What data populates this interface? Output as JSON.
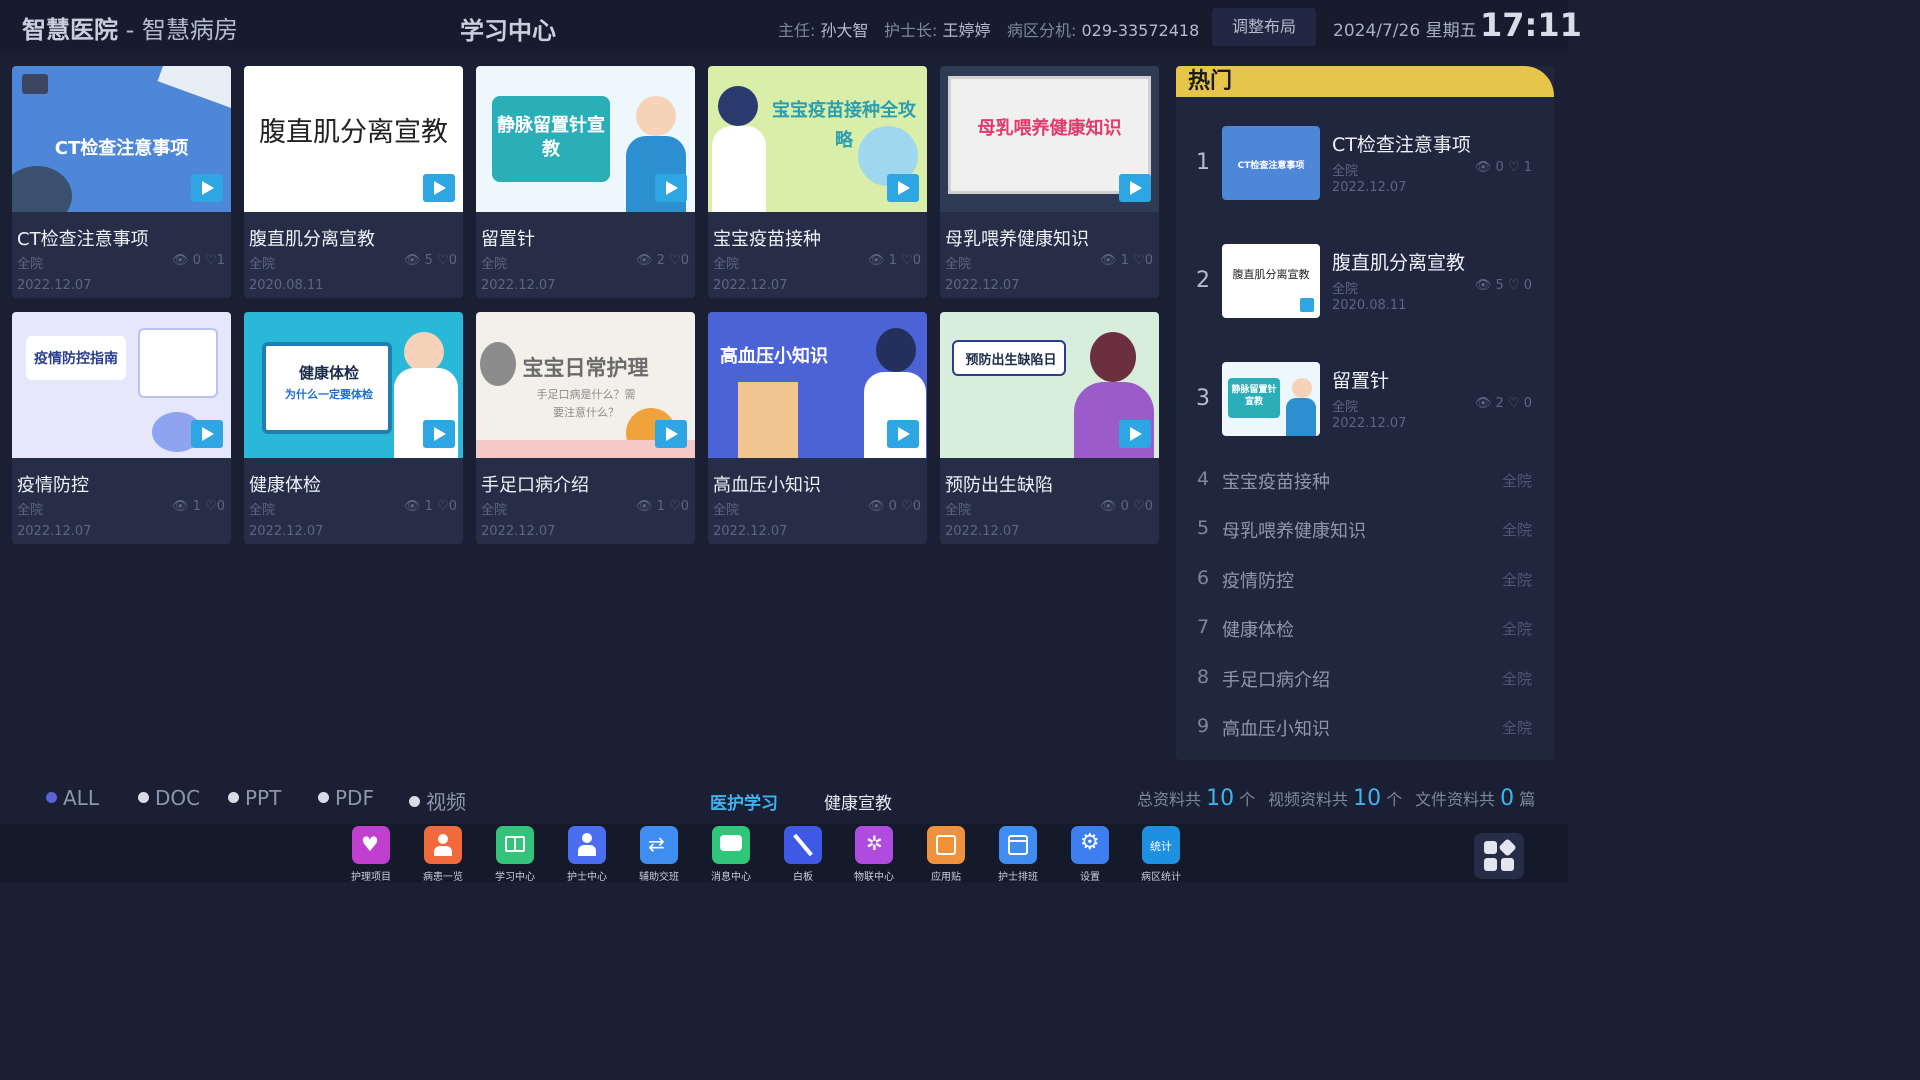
{
  "header": {
    "brand": "智慧医院",
    "subbrand": " - 智慧病房",
    "title": "学习中心",
    "director_label": "主任:",
    "director": "孙大智",
    "nurse_label": "护士长:",
    "nurse": "王婷婷",
    "ext_label": "病区分机:",
    "ext": "029-33572418",
    "layout_button": "调整布局",
    "date": "2024/7/26 星期五",
    "time": "17:11"
  },
  "cards": [
    {
      "title": "CT检查注意事项",
      "thumb_text": "CT检查注意事项",
      "scope": "全院",
      "views": "0",
      "likes": "1",
      "date": "2022.12.07"
    },
    {
      "title": "腹直肌分离宣教",
      "thumb_text": "腹直肌分离宣教",
      "scope": "全院",
      "views": "5",
      "likes": "0",
      "date": "2020.08.11"
    },
    {
      "title": "留置针",
      "thumb_text": "静脉留置针宣教",
      "scope": "全院",
      "views": "2",
      "likes": "0",
      "date": "2022.12.07"
    },
    {
      "title": "宝宝疫苗接种",
      "thumb_text": "宝宝疫苗接种全攻略",
      "scope": "全院",
      "views": "1",
      "likes": "0",
      "date": "2022.12.07"
    },
    {
      "title": "母乳喂养健康知识",
      "thumb_text": "母乳喂养健康知识",
      "scope": "全院",
      "views": "1",
      "likes": "0",
      "date": "2022.12.07"
    },
    {
      "title": "疫情防控",
      "thumb_text": "疫情防控指南",
      "scope": "全院",
      "views": "1",
      "likes": "0",
      "date": "2022.12.07"
    },
    {
      "title": "健康体检",
      "thumb_text": "健康体检",
      "thumb_sub": "为什么一定要体检",
      "scope": "全院",
      "views": "1",
      "likes": "0",
      "date": "2022.12.07"
    },
    {
      "title": "手足口病介绍",
      "thumb_text": "宝宝日常护理",
      "thumb_sub": "手足口病是什么？需要注意什么？",
      "scope": "全院",
      "views": "1",
      "likes": "0",
      "date": "2022.12.07"
    },
    {
      "title": "高血压小知识",
      "thumb_text": "高血压小知识",
      "scope": "全院",
      "views": "0",
      "likes": "0",
      "date": "2022.12.07"
    },
    {
      "title": "预防出生缺陷",
      "thumb_text": "预防出生缺陷日",
      "scope": "全院",
      "views": "0",
      "likes": "0",
      "date": "2022.12.07"
    }
  ],
  "hot": {
    "title": "热门",
    "top": [
      {
        "rank": "1",
        "title": "CT检查注意事项",
        "thumb_text": "CT检查注意事项",
        "scope": "全院",
        "views": "0",
        "likes": "1",
        "date": "2022.12.07"
      },
      {
        "rank": "2",
        "title": "腹直肌分离宣教",
        "thumb_text": "腹直肌分离宣教",
        "scope": "全院",
        "views": "5",
        "likes": "0",
        "date": "2020.08.11"
      },
      {
        "rank": "3",
        "title": "留置针",
        "thumb_text": "静脉留置针宣教",
        "scope": "全院",
        "views": "2",
        "likes": "0",
        "date": "2022.12.07"
      }
    ],
    "rest": [
      {
        "rank": "4",
        "title": "宝宝疫苗接种",
        "scope": "全院"
      },
      {
        "rank": "5",
        "title": "母乳喂养健康知识",
        "scope": "全院"
      },
      {
        "rank": "6",
        "title": "疫情防控",
        "scope": "全院"
      },
      {
        "rank": "7",
        "title": "健康体检",
        "scope": "全院"
      },
      {
        "rank": "8",
        "title": "手足口病介绍",
        "scope": "全院"
      },
      {
        "rank": "9",
        "title": "高血压小知识",
        "scope": "全院"
      }
    ]
  },
  "filters": [
    "ALL",
    "DOC",
    "PPT",
    "PDF",
    "视频"
  ],
  "tabs": {
    "active": "医护学习",
    "other": "健康宣教"
  },
  "summary": {
    "total_label": "总资料共",
    "total": "10",
    "total_unit": "个",
    "video_label": "视频资料共",
    "video": "10",
    "video_unit": "个",
    "file_label": "文件资料共",
    "file": "0",
    "file_unit": "篇"
  },
  "dock": [
    {
      "label": "护理项目",
      "icon": "heart-monitor-icon",
      "color": "#c13fcf"
    },
    {
      "label": "病患一览",
      "icon": "patient-icon",
      "color": "#f06a3b"
    },
    {
      "label": "学习中心",
      "icon": "book-icon",
      "color": "#34c37a"
    },
    {
      "label": "护士中心",
      "icon": "nurse-icon",
      "color": "#4b6ef0"
    },
    {
      "label": "辅助交班",
      "icon": "swap-icon",
      "color": "#3d8ef0"
    },
    {
      "label": "消息中心",
      "icon": "chat-icon",
      "color": "#2fc67a"
    },
    {
      "label": "白板",
      "icon": "pen-icon",
      "color": "#3d59e6"
    },
    {
      "label": "物联中心",
      "icon": "network-icon",
      "color": "#b04be0"
    },
    {
      "label": "应用贴",
      "icon": "app-card-icon",
      "color": "#f0923b"
    },
    {
      "label": "护士排班",
      "icon": "calendar-icon",
      "color": "#3d8ef0"
    },
    {
      "label": "设置",
      "icon": "gear-icon",
      "color": "#3d7ff0"
    },
    {
      "label": "病区统计",
      "icon": "stats-icon",
      "icon_text": "统计",
      "color": "#1e90e0"
    }
  ]
}
